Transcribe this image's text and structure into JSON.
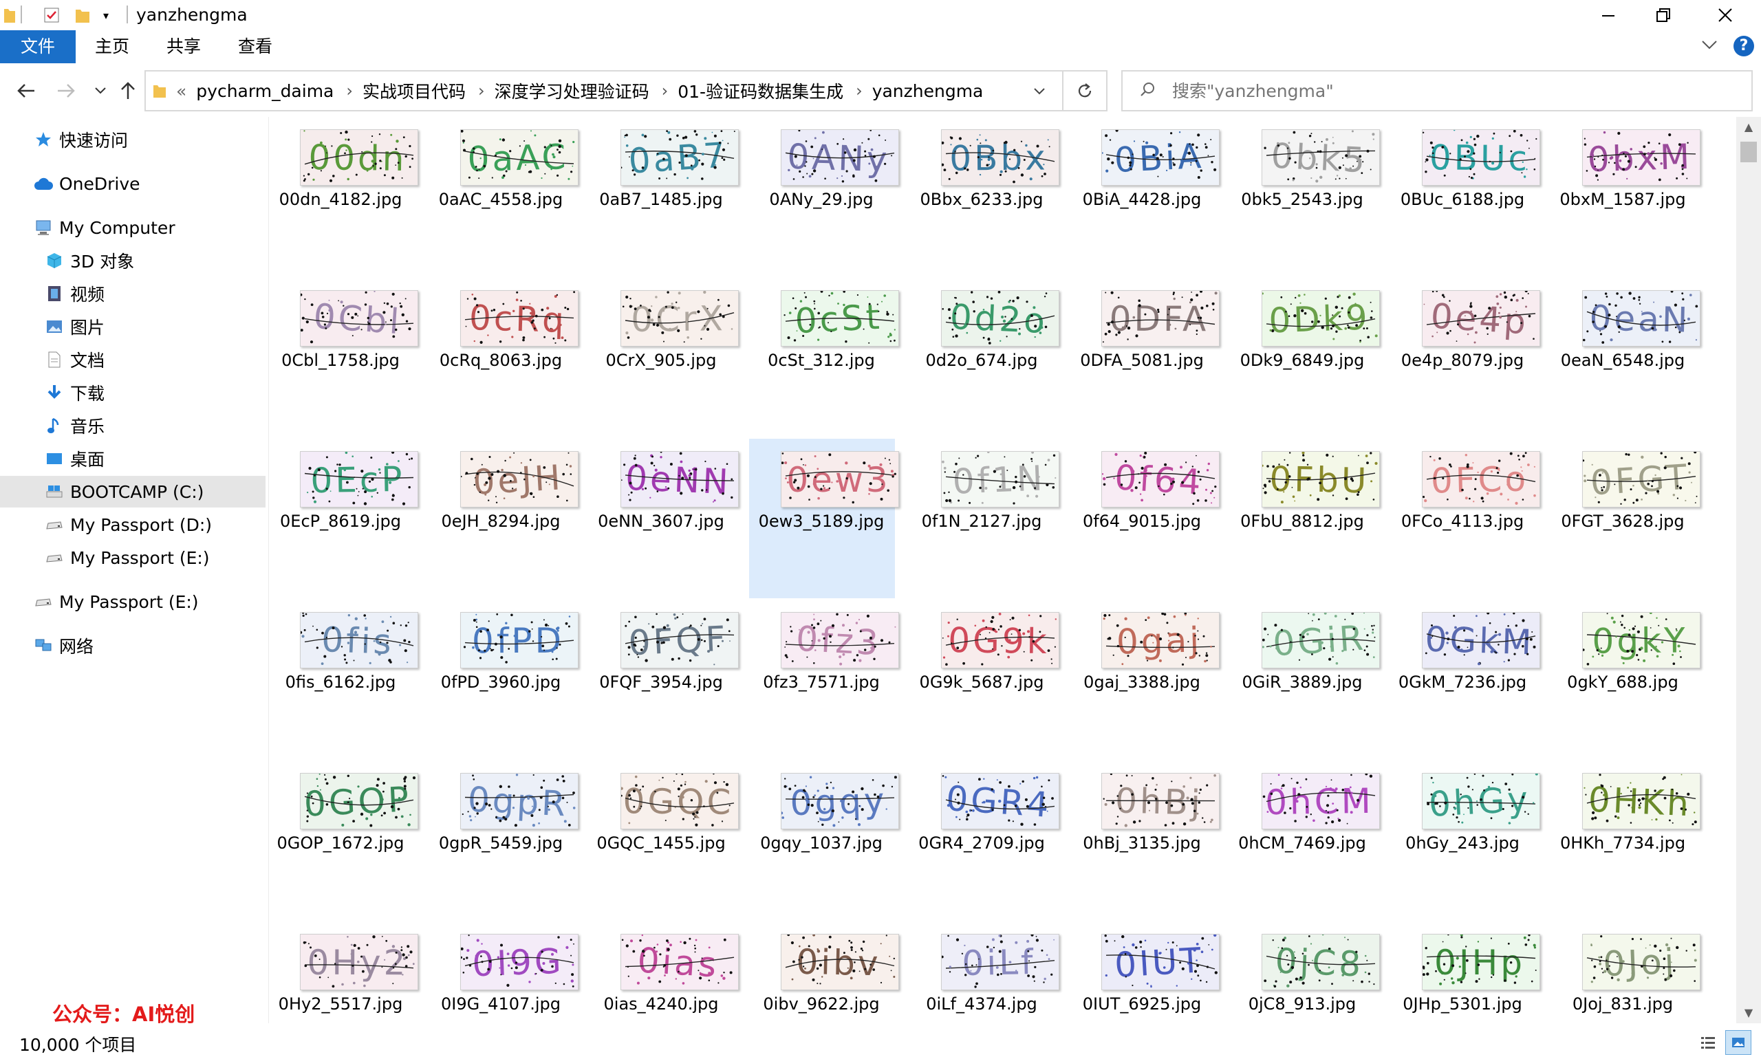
{
  "window": {
    "title": "yanzhengma",
    "controls": [
      "minimize",
      "maximize",
      "close"
    ]
  },
  "ribbon": {
    "tabs": [
      "文件",
      "主页",
      "共享",
      "查看"
    ],
    "active_tab": "文件"
  },
  "address": {
    "breadcrumbs": [
      "pycharm_daima",
      "实战项目代码",
      "深度学习处理验证码",
      "01-验证码数据集生成",
      "yanzhengma"
    ],
    "overflow_glyph": "«"
  },
  "search": {
    "placeholder": "搜索\"yanzhengma\""
  },
  "sidebar": {
    "items": [
      {
        "label": "快速访问",
        "icon": "star-icon"
      },
      {
        "label": "OneDrive",
        "icon": "cloud-icon"
      },
      {
        "label": "My Computer",
        "icon": "computer-icon"
      },
      {
        "label": "3D 对象",
        "icon": "cube-icon"
      },
      {
        "label": "视频",
        "icon": "video-icon"
      },
      {
        "label": "图片",
        "icon": "picture-icon"
      },
      {
        "label": "文档",
        "icon": "document-icon"
      },
      {
        "label": "下载",
        "icon": "download-icon"
      },
      {
        "label": "音乐",
        "icon": "music-icon"
      },
      {
        "label": "桌面",
        "icon": "desktop-icon"
      },
      {
        "label": "BOOTCAMP (C:)",
        "icon": "drive-c-icon"
      },
      {
        "label": "My Passport (D:)",
        "icon": "drive-icon"
      },
      {
        "label": "My Passport (E:)",
        "icon": "drive-icon"
      },
      {
        "label": "My Passport (E:)",
        "icon": "drive-icon"
      },
      {
        "label": "网络",
        "icon": "network-icon"
      }
    ],
    "selected_index": 10
  },
  "files": [
    {
      "name": "00dn_4182.jpg",
      "code": "00dn",
      "color": "#5a9a3a",
      "bg": "#f6ecec"
    },
    {
      "name": "0aAC_4558.jpg",
      "code": "0aAC",
      "color": "#3aa058",
      "bg": "#f4f4ec"
    },
    {
      "name": "0aB7_1485.jpg",
      "code": "0aB7",
      "color": "#3a8aa0",
      "bg": "#eef4f4"
    },
    {
      "name": "0ANy_29.jpg",
      "code": "0ANy",
      "color": "#7070a8",
      "bg": "#ececf8"
    },
    {
      "name": "0Bbx_6233.jpg",
      "code": "0Bbx",
      "color": "#3a7aa0",
      "bg": "#f4ecec"
    },
    {
      "name": "0BiA_4428.jpg",
      "code": "0BiA",
      "color": "#3a6ab0",
      "bg": "#eef2f8"
    },
    {
      "name": "0bk5_2543.jpg",
      "code": "0bk5",
      "color": "#a0a0a0",
      "bg": "#f4f4f4"
    },
    {
      "name": "0BUc_6188.jpg",
      "code": "0BUc",
      "color": "#2aa0a0",
      "bg": "#f4ecf4"
    },
    {
      "name": "0bxM_1587.jpg",
      "code": "0bxM",
      "color": "#9a4a9a",
      "bg": "#f8ecf4"
    },
    {
      "name": "0Cbl_1758.jpg",
      "code": "0Cbl",
      "color": "#a08ab0",
      "bg": "#f8ecf0"
    },
    {
      "name": "0cRq_8063.jpg",
      "code": "0cRq",
      "color": "#c05050",
      "bg": "#f8ecec"
    },
    {
      "name": "0CrX_905.jpg",
      "code": "0CrX",
      "color": "#b0a8a0",
      "bg": "#f8f0ec"
    },
    {
      "name": "0cSt_312.jpg",
      "code": "0cSt",
      "color": "#4a9a4a",
      "bg": "#ecf8ec"
    },
    {
      "name": "0d2o_674.jpg",
      "code": "0d2o",
      "color": "#3a9a6a",
      "bg": "#ecf4ec"
    },
    {
      "name": "0DFA_5081.jpg",
      "code": "0DFA",
      "color": "#8a7a7a",
      "bg": "#f8f0f0"
    },
    {
      "name": "0Dk9_6849.jpg",
      "code": "0Dk9",
      "color": "#6aa04a",
      "bg": "#ecf8e8"
    },
    {
      "name": "0e4p_8079.jpg",
      "code": "0e4p",
      "color": "#a06a7a",
      "bg": "#f8ecf0"
    },
    {
      "name": "0eaN_6548.jpg",
      "code": "0eaN",
      "color": "#6a7ab0",
      "bg": "#ecf0f8"
    },
    {
      "name": "0EcP_8619.jpg",
      "code": "0EcP",
      "color": "#3aa07a",
      "bg": "#f4ecf8"
    },
    {
      "name": "0eJH_8294.jpg",
      "code": "0eJH",
      "color": "#a0786a",
      "bg": "#f8f0ec"
    },
    {
      "name": "0eNN_3607.jpg",
      "code": "0eNN",
      "color": "#a03ab0",
      "bg": "#f0ecf8"
    },
    {
      "name": "0ew3_5189.jpg",
      "code": "0ew3",
      "color": "#d06a7a",
      "bg": "#f8ecec"
    },
    {
      "name": "0f1N_2127.jpg",
      "code": "0f1N",
      "color": "#b0b0b0",
      "bg": "#f4f8f4"
    },
    {
      "name": "0f64_9015.jpg",
      "code": "0f64",
      "color": "#c04aa0",
      "bg": "#f8ecf4"
    },
    {
      "name": "0FbU_8812.jpg",
      "code": "0FbU",
      "color": "#8a8a2a",
      "bg": "#f4f8e8"
    },
    {
      "name": "0FCo_4113.jpg",
      "code": "0FCo",
      "color": "#e08a8a",
      "bg": "#f8ecec"
    },
    {
      "name": "0FGT_3628.jpg",
      "code": "0FGT",
      "color": "#a0a08a",
      "bg": "#f8f8ec"
    },
    {
      "name": "0fis_6162.jpg",
      "code": "0fis",
      "color": "#6a8ab0",
      "bg": "#ecf0f8"
    },
    {
      "name": "0fPD_3960.jpg",
      "code": "0fPD",
      "color": "#4a7ac0",
      "bg": "#ecf4f8"
    },
    {
      "name": "0FQF_3954.jpg",
      "code": "0FQF",
      "color": "#6a7a8a",
      "bg": "#f0f4f4"
    },
    {
      "name": "0fz3_7571.jpg",
      "code": "0fz3",
      "color": "#c08ab0",
      "bg": "#f8ecf4"
    },
    {
      "name": "0G9k_5687.jpg",
      "code": "0G9k",
      "color": "#d04a5a",
      "bg": "#f8ecec"
    },
    {
      "name": "0gaj_3388.jpg",
      "code": "0gaj",
      "color": "#c06a5a",
      "bg": "#f8f0ec"
    },
    {
      "name": "0GiR_3889.jpg",
      "code": "0GiR",
      "color": "#7ab08a",
      "bg": "#ecf8f0"
    },
    {
      "name": "0GkM_7236.jpg",
      "code": "0GkM",
      "color": "#5a6ab0",
      "bg": "#ececf8"
    },
    {
      "name": "0gkY_688.jpg",
      "code": "0gkY",
      "color": "#5aa04a",
      "bg": "#f4f8ec"
    },
    {
      "name": "0GOP_1672.jpg",
      "code": "0GOP",
      "color": "#3a8a5a",
      "bg": "#ecf4ec"
    },
    {
      "name": "0gpR_5459.jpg",
      "code": "0gpR",
      "color": "#6a8ac0",
      "bg": "#ecf0f8"
    },
    {
      "name": "0GQC_1455.jpg",
      "code": "0GQC",
      "color": "#a08a7a",
      "bg": "#f8f0ec"
    },
    {
      "name": "0gqy_1037.jpg",
      "code": "0gqy",
      "color": "#5a7ac0",
      "bg": "#ecf0f8"
    },
    {
      "name": "0GR4_2709.jpg",
      "code": "0GR4",
      "color": "#4a6ac0",
      "bg": "#eceff8"
    },
    {
      "name": "0hBj_3135.jpg",
      "code": "0hBj",
      "color": "#a0908a",
      "bg": "#f8f0f0"
    },
    {
      "name": "0hCM_7469.jpg",
      "code": "0hCM",
      "color": "#b04ac0",
      "bg": "#f4ecf8"
    },
    {
      "name": "0hGy_243.jpg",
      "code": "0hGy",
      "color": "#3aa08a",
      "bg": "#ecf8f4"
    },
    {
      "name": "0HKh_7734.jpg",
      "code": "0HKh",
      "color": "#6a8a2a",
      "bg": "#f4f8ec"
    },
    {
      "name": "0Hy2_5517.jpg",
      "code": "0Hy2",
      "color": "#9a8aa0",
      "bg": "#f8ecf0"
    },
    {
      "name": "0I9G_4107.jpg",
      "code": "0I9G",
      "color": "#a04ac0",
      "bg": "#f4ecf8"
    },
    {
      "name": "0ias_4240.jpg",
      "code": "0ias",
      "color": "#c04a9a",
      "bg": "#f8ecf4"
    },
    {
      "name": "0ibv_9622.jpg",
      "code": "0ibv",
      "color": "#7a5a4a",
      "bg": "#f8f0ec"
    },
    {
      "name": "0iLf_4374.jpg",
      "code": "0iLf",
      "color": "#8a8ac0",
      "bg": "#eeeef8"
    },
    {
      "name": "0IUT_6925.jpg",
      "code": "0IUT",
      "color": "#4a5ac0",
      "bg": "#ececf8"
    },
    {
      "name": "0jC8_913.jpg",
      "code": "0jC8",
      "color": "#5a9a6a",
      "bg": "#ecf4ec"
    },
    {
      "name": "0JHp_5301.jpg",
      "code": "0JHp",
      "color": "#3a8a3a",
      "bg": "#ecf8ec"
    },
    {
      "name": "0Joj_831.jpg",
      "code": "0Joj",
      "color": "#8a9a7a",
      "bg": "#f4f8ec"
    }
  ],
  "selected_file": "0ew3_5189.jpg",
  "status": {
    "count_text": "10,000 个项目"
  },
  "watermark": "公众号：AI悦创",
  "colors": {
    "accent": "#1a6fc8",
    "selection": "#dcebfc",
    "watermark": "#e31b1b"
  }
}
